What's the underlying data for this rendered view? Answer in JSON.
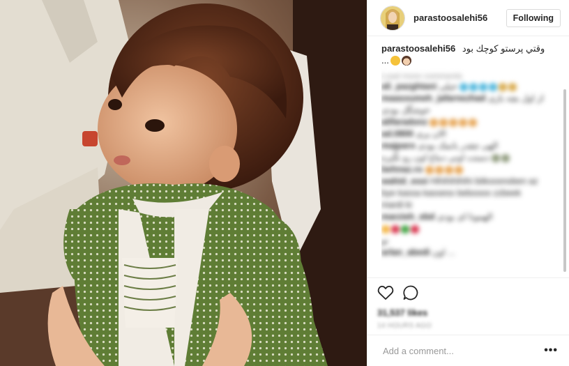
{
  "header": {
    "username": "parastoosalehi56",
    "follow_label": "Following"
  },
  "caption": {
    "username": "parastoosalehi56",
    "text": "وقتي پرستو كوچك بود",
    "ellipsis": "..."
  },
  "comments": {
    "load_more": "Load more comments",
    "items": [
      {
        "user": "ali_pazghtani",
        "text": "خیلی",
        "dots": [
          "#4fb7dd",
          "#4fb7dd",
          "#4fb7dd",
          "#4fb7dd",
          "#d8a94a",
          "#d8a94a"
        ]
      },
      {
        "user": "maasoumeh_jafarnezhad",
        "text": "از اول بچه بازی",
        "dots": []
      },
      {
        "user": "",
        "text": "خوشگل بودی",
        "dots": []
      },
      {
        "user": "alifaradonz",
        "text": "",
        "dots": [
          "#e7a657",
          "#e7a657",
          "#e7a657",
          "#e7a657",
          "#e7a657"
        ]
      },
      {
        "user": "ad.0800",
        "text": "الان پری",
        "dots": []
      },
      {
        "user": "majparo",
        "text": "الهی چقدر بانمک بودی",
        "dots": []
      },
      {
        "user": "",
        "text": "دستت اونی دماغ اون رو نگیره",
        "dots": [
          "#8e9a7c",
          "#8e9a7c"
        ]
      },
      {
        "user": "behnaz.ro",
        "text": "",
        "dots": [
          "#e7a657",
          "#e7a657",
          "#e7a657",
          "#e7a657"
        ]
      },
      {
        "user": "wahid_essi",
        "text": "Hihihihihihi biikoosnoben az",
        "dots": []
      },
      {
        "user": "",
        "text": "bye kassa kassess beboooo zzbeek",
        "dots": []
      },
      {
        "user": "",
        "text": "mardi ki",
        "dots": []
      },
      {
        "user": "marzieh_ebd",
        "text": "الهمونا ای بودی",
        "dots": []
      },
      {
        "user": "",
        "text": "",
        "dots": [
          "#f3b33d",
          "#d8314c",
          "#3aa23d",
          "#d8314c"
        ]
      },
      {
        "user": "",
        "text": "تو",
        "dots": []
      },
      {
        "user": "arlan_abedi",
        "text": "اون ...",
        "dots": []
      }
    ]
  },
  "likes": "31,537 likes",
  "time_ago": "14 HOURS AGO",
  "add_comment": {
    "placeholder": "Add a comment...",
    "more_label": "•••"
  },
  "icons": {
    "like": "heart-icon",
    "comment": "comment-icon"
  },
  "colors": {
    "border": "#efefef",
    "text": "#262626",
    "muted": "#999999",
    "photo_dress": "#5f7d35"
  }
}
